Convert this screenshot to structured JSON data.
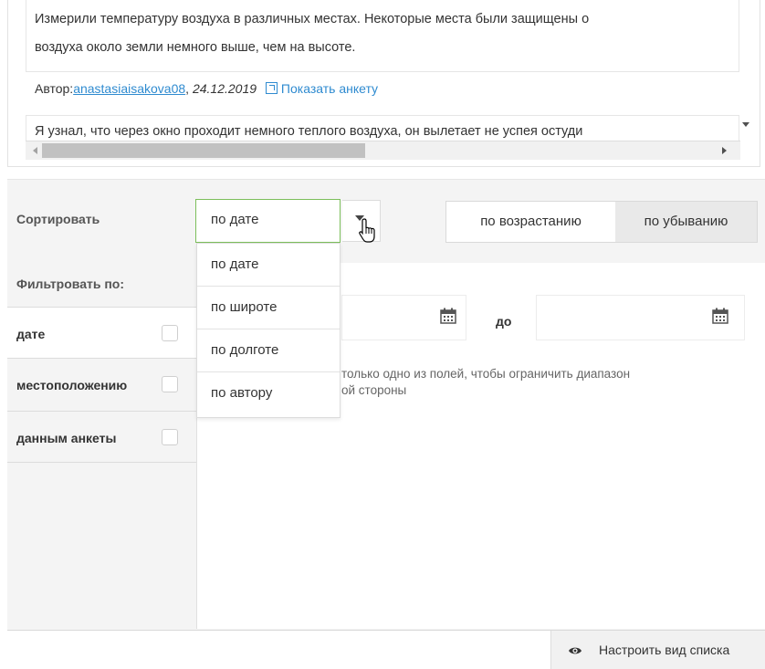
{
  "answers": {
    "first_line1": "Измерили температуру воздуха в различных местах. Некоторые места были защищены о",
    "first_line2": "воздуха около земли немного выше, чем на высоте.",
    "author_prefix": "Автор:",
    "author_name": "anastasiaisakova08",
    "date": "24.12.2019",
    "show_profile": "Показать анкету",
    "second_line": "Я узнал, что через окно проходит немного теплого воздуха, он вылетает не успея остуди"
  },
  "sort": {
    "label": "Сортировать",
    "selected": "по дате",
    "options": [
      "по дате",
      "по широте",
      "по долготе",
      "по автору"
    ],
    "order_asc": "по возрастанию",
    "order_desc": "по убыванию",
    "active_order": "по убыванию"
  },
  "filter": {
    "label": "Фильтровать по:",
    "tabs": [
      "дате",
      "местоположению",
      "данным анкеты"
    ],
    "active_tab": "дате",
    "to_label": "до",
    "hint_line1": "только одно из полей, чтобы ограничить диапазон",
    "hint_line2": "ой стороны"
  },
  "footer": {
    "configure_view": "Настроить вид списка"
  },
  "colors": {
    "link": "#2f8bd0",
    "select_border": "#7cbf5b",
    "panel_bg": "#f4f4f4"
  }
}
